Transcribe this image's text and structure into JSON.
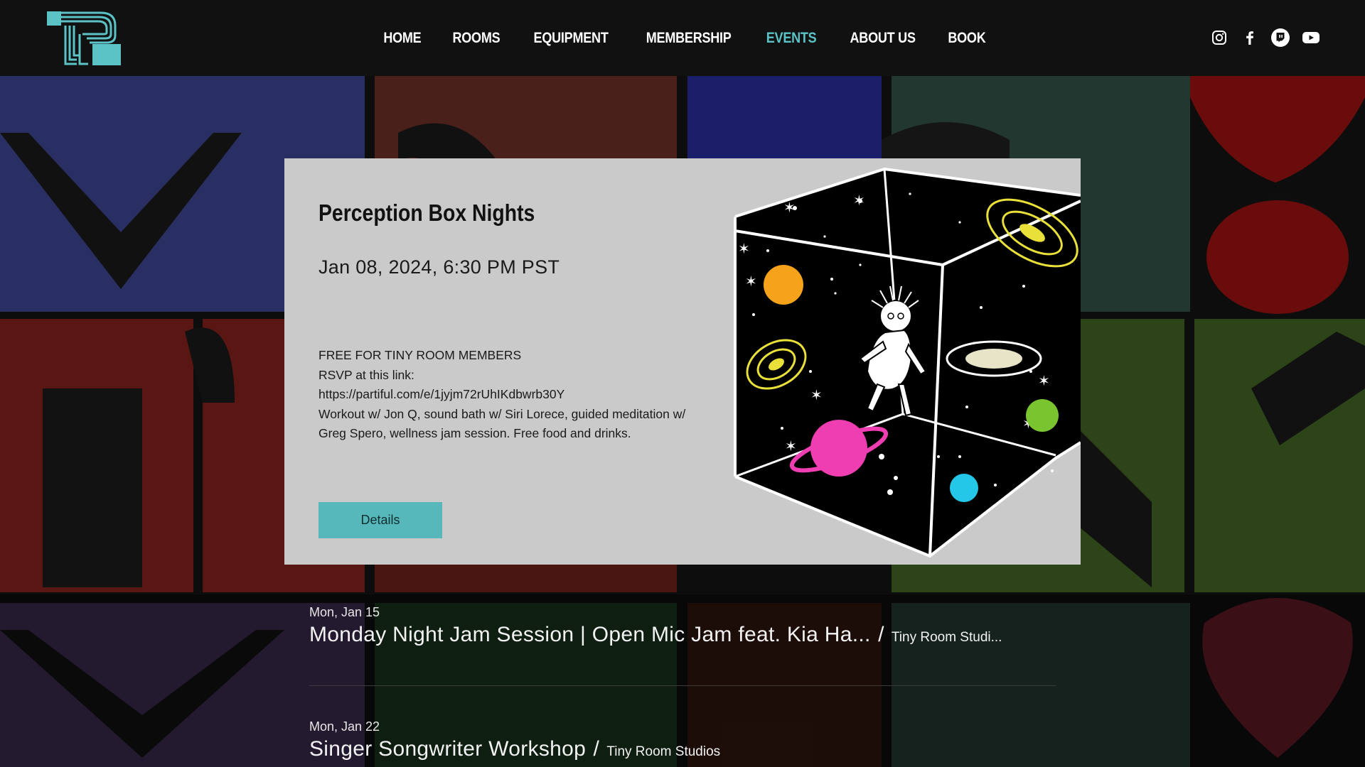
{
  "nav": {
    "items": [
      {
        "label": "HOME",
        "active": false
      },
      {
        "label": "ROOMS",
        "active": false
      },
      {
        "label": "EQUIPMENT",
        "active": false
      },
      {
        "label": "MEMBERSHIP",
        "active": false
      },
      {
        "label": "EVENTS",
        "active": true
      },
      {
        "label": "ABOUT US",
        "active": false
      },
      {
        "label": "BOOK",
        "active": false
      }
    ],
    "accent_color": "#5bc3c6"
  },
  "social": [
    "instagram-icon",
    "facebook-icon",
    "twitch-icon",
    "youtube-icon"
  ],
  "featured": {
    "title": "Perception Box Nights",
    "date": "Jan 08, 2024, 6:30 PM PST",
    "description_lines": [
      "FREE FOR TINY ROOM MEMBERS",
      "RSVP at this link:",
      "https://partiful.com/e/1jyjm72rUhIKdbwrb30Y",
      "Workout w/ Jon Q, sound bath w/ Siri Lorece, guided meditation w/ Greg Spero, wellness jam session. Free food and drinks."
    ],
    "button_label": "Details"
  },
  "events": [
    {
      "date": "Mon, Jan 15",
      "title": "Monday Night Jam Session | Open Mic Jam feat. Kia Ha...",
      "separator": "/",
      "venue": "Tiny Room Studi..."
    },
    {
      "date": "Mon, Jan 22",
      "title": "Singer Songwriter Workshop",
      "separator": "/",
      "venue": "Tiny Room Studios"
    }
  ],
  "colors": {
    "header_bg": "#111111",
    "card_bg": "#cacaca",
    "button_bg": "#56b8bb"
  }
}
